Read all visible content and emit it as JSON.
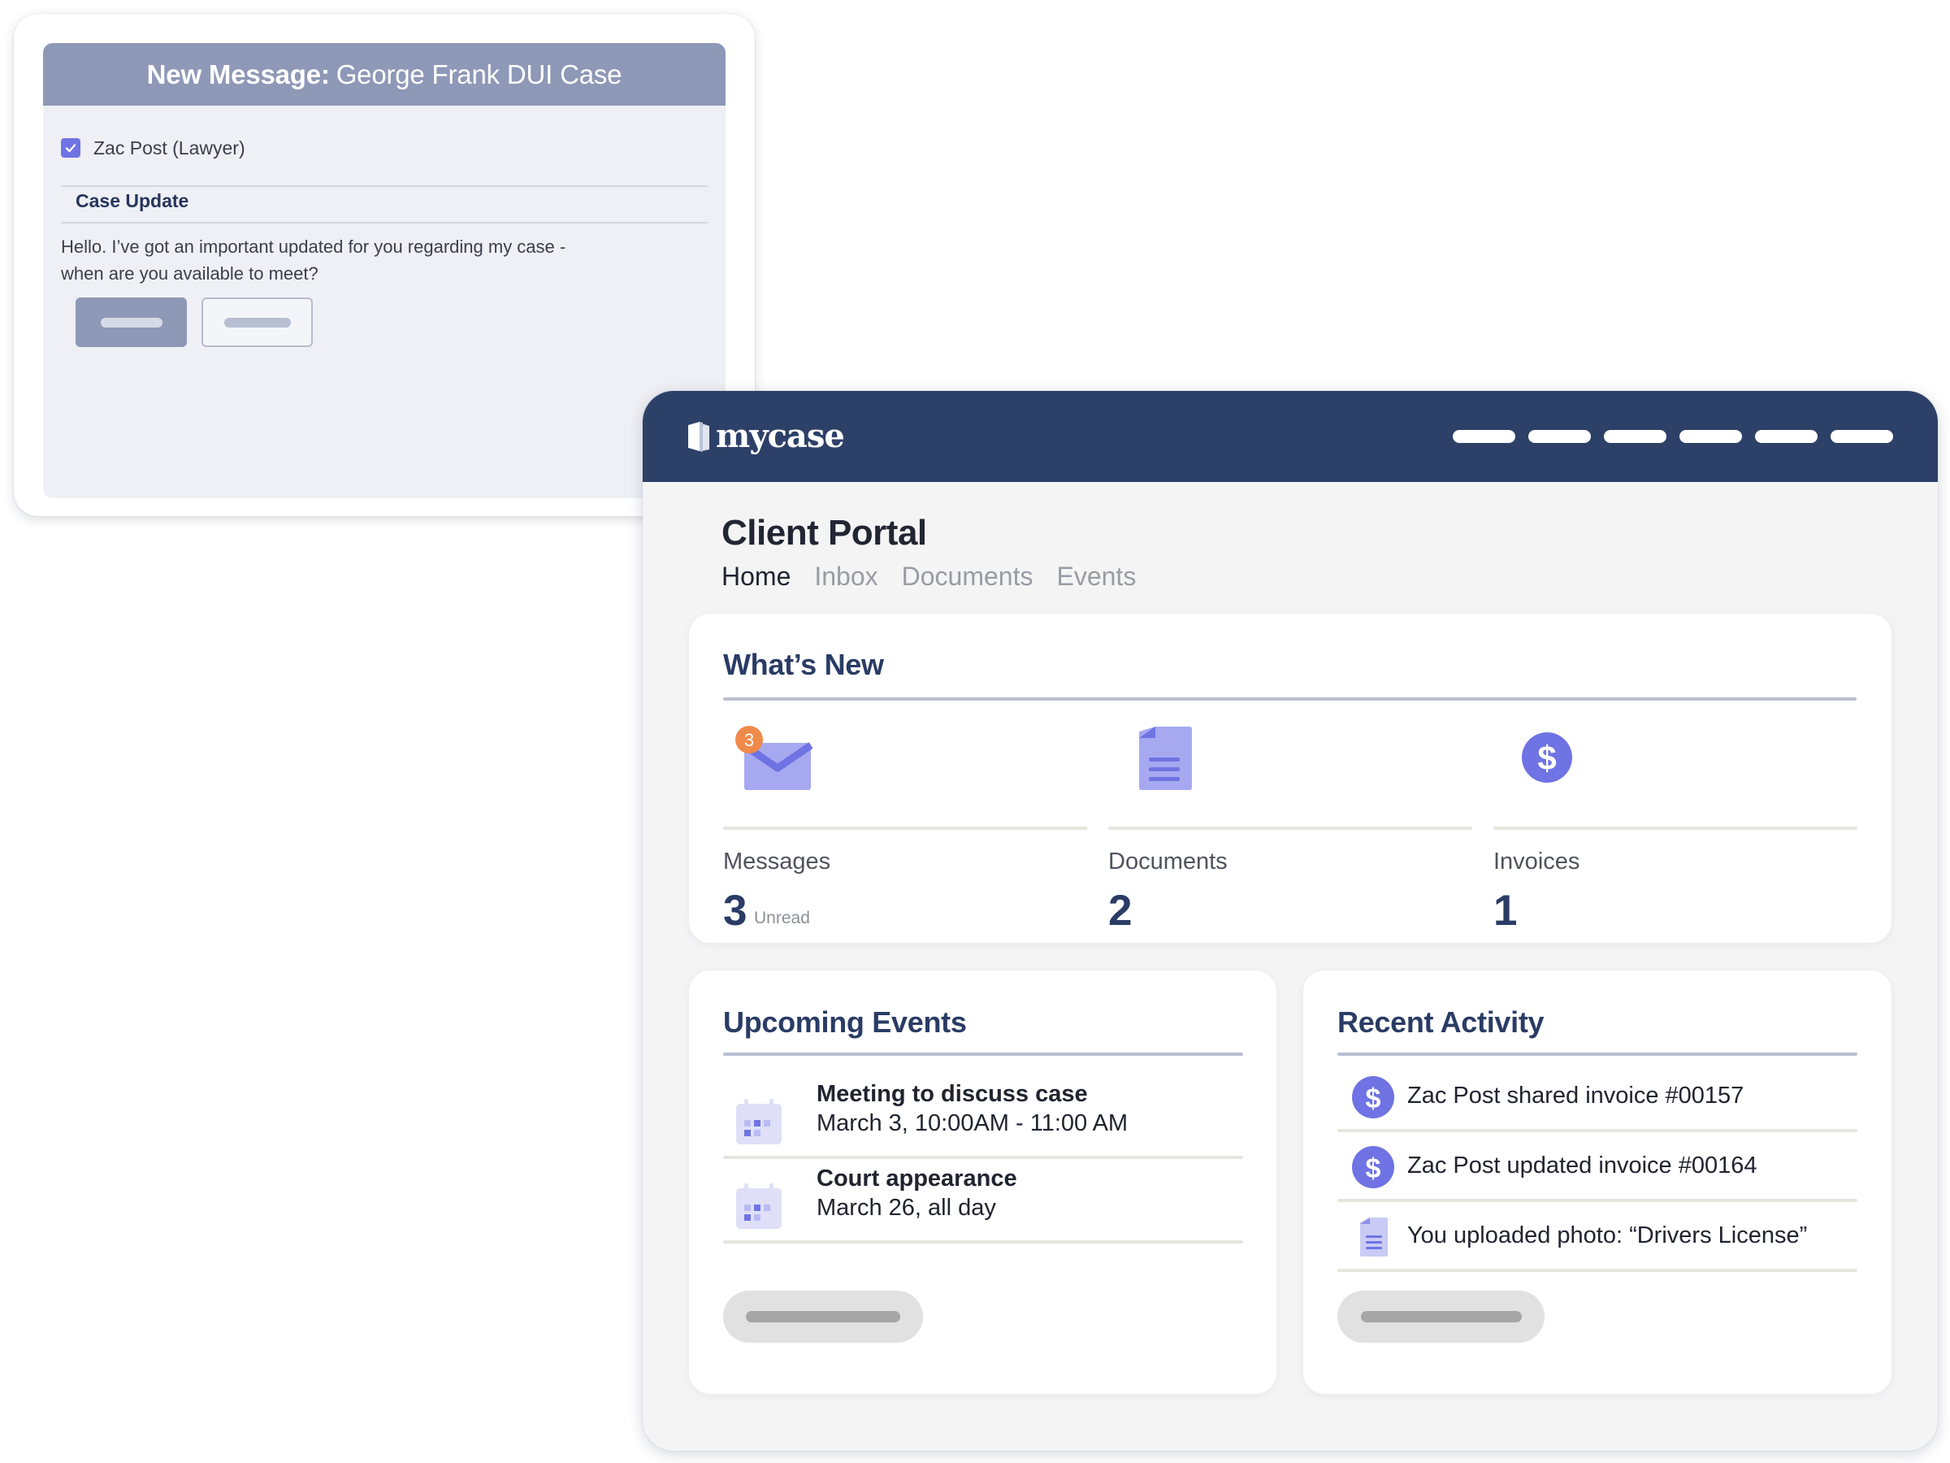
{
  "message": {
    "title_strong": "New Message:",
    "title_light": "George Frank DUI Case",
    "recipient": "Zac Post (Lawyer)",
    "recipient_checked": true,
    "subject": "Case Update",
    "body": "Hello. I’ve got an important updated for you regarding my case - when are you available to meet?"
  },
  "portal": {
    "brand": "mycase",
    "title": "Client Portal",
    "tabs": [
      {
        "label": "Home",
        "active": true
      },
      {
        "label": "Inbox",
        "active": false
      },
      {
        "label": "Documents",
        "active": false
      },
      {
        "label": "Events",
        "active": false
      }
    ],
    "whats_new": {
      "title": "What’s New",
      "messages": {
        "label": "Messages",
        "value": "3",
        "sub": "Unread",
        "badge": "3",
        "icon": "envelope-icon"
      },
      "documents": {
        "label": "Documents",
        "value": "2",
        "icon": "document-icon"
      },
      "invoices": {
        "label": "Invoices",
        "value": "1",
        "icon": "dollar-icon"
      }
    },
    "events": {
      "title": "Upcoming Events",
      "items": [
        {
          "title": "Meeting to discuss case",
          "when": "March 3, 10:00AM - 11:00 AM",
          "icon": "calendar-icon"
        },
        {
          "title": "Court appearance",
          "when": "March 26, all day",
          "icon": "calendar-icon"
        }
      ]
    },
    "activity": {
      "title": "Recent Activity",
      "items": [
        {
          "text": "Zac Post shared invoice #00157",
          "icon": "dollar-icon"
        },
        {
          "text": "Zac Post updated invoice #00164",
          "icon": "dollar-icon"
        },
        {
          "text": "You uploaded photo: “Drivers License”",
          "icon": "document-icon"
        }
      ]
    }
  },
  "colors": {
    "navy": "#2d4068",
    "accent": "#6f73e3",
    "badge": "#f08a4b",
    "message_header": "#8e98b7"
  }
}
